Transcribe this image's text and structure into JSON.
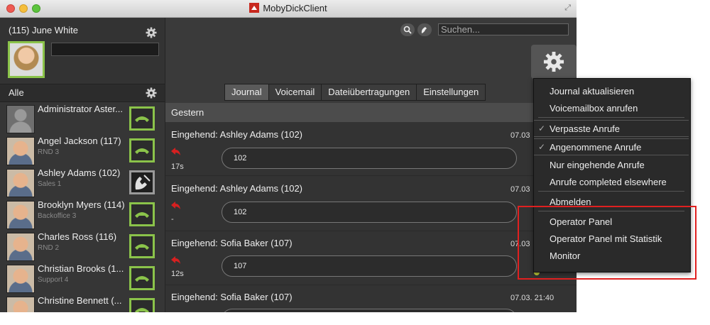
{
  "window": {
    "title": "MobyDickClient"
  },
  "profile": {
    "name": "(115) June White"
  },
  "sidebar": {
    "filter_label": "Alle",
    "contacts": [
      {
        "name": "Administrator Aster...",
        "dept": "",
        "status": "available"
      },
      {
        "name": "Angel Jackson (117)",
        "dept": "RND 3",
        "status": "available"
      },
      {
        "name": "Ashley Adams (102)",
        "dept": "Sales 1",
        "status": "busy"
      },
      {
        "name": "Brooklyn Myers (114)",
        "dept": "Backoffice 3",
        "status": "available"
      },
      {
        "name": "Charles Ross (116)",
        "dept": "RND 2",
        "status": "available"
      },
      {
        "name": "Christian Brooks (1...",
        "dept": "Support 4",
        "status": "available"
      },
      {
        "name": "Christine Bennett (...",
        "dept": "",
        "status": "available"
      }
    ]
  },
  "search": {
    "placeholder": "Suchen..."
  },
  "tabs": [
    {
      "label": "Journal",
      "active": true
    },
    {
      "label": "Voicemail",
      "active": false
    },
    {
      "label": "Dateiübertragungen",
      "active": false
    },
    {
      "label": "Einstellungen",
      "active": false
    }
  ],
  "journal": {
    "group_label": "Gestern",
    "entries": [
      {
        "title": "Eingehend: Ashley Adams (102)",
        "time": "07.03",
        "duration": "17s",
        "number": "102"
      },
      {
        "title": "Eingehend: Ashley Adams (102)",
        "time": "07.03",
        "duration": "-",
        "number": "102"
      },
      {
        "title": "Eingehend: Sofia Baker (107)",
        "time": "07.03",
        "duration": "12s",
        "number": "107"
      },
      {
        "title": "Eingehend: Sofia Baker (107)",
        "time": "07.03. 21:40",
        "duration": "",
        "number": ""
      }
    ]
  },
  "menu": {
    "items": [
      {
        "label": "Journal aktualisieren",
        "checked": false
      },
      {
        "label": "Voicemailbox anrufen",
        "checked": false
      },
      {
        "label": "Verpasste Anrufe",
        "checked": true
      },
      {
        "label": "Angenommene Anrufe",
        "checked": true
      },
      {
        "label": "Nur eingehende Anrufe",
        "checked": false
      },
      {
        "label": "Anrufe completed elsewhere",
        "checked": false
      },
      {
        "label": "Abmelden",
        "checked": false
      },
      {
        "label": "Operator Panel",
        "checked": false
      },
      {
        "label": "Operator Panel mit Statistik",
        "checked": false
      },
      {
        "label": "Monitor",
        "checked": false
      }
    ],
    "check_mark": "✓"
  },
  "colors": {
    "accent_green": "#8bc34a",
    "highlight_red": "#e02020",
    "missed_call_red": "#d62020"
  }
}
